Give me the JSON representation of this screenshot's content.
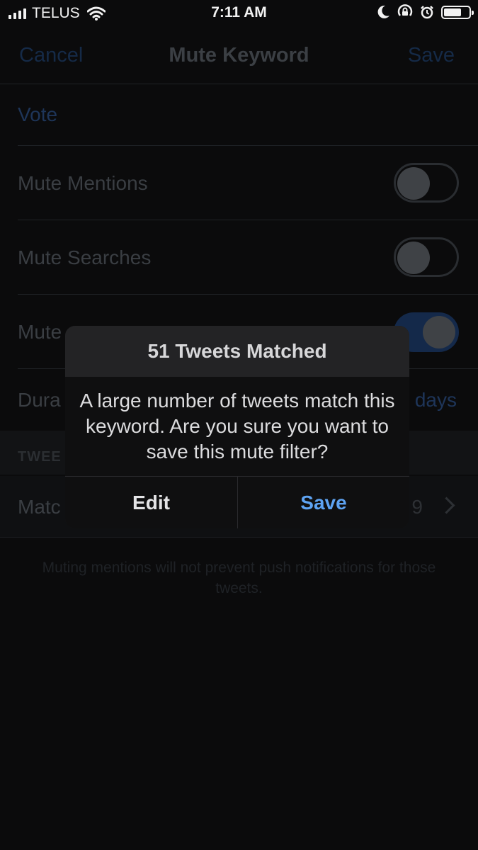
{
  "status_bar": {
    "carrier": "TELUS",
    "time": "7:11 AM",
    "icons": [
      "signal-icon",
      "wifi-icon",
      "moon-icon",
      "orientation-lock-icon",
      "alarm-icon",
      "battery-icon"
    ]
  },
  "nav": {
    "cancel": "Cancel",
    "title": "Mute Keyword",
    "save": "Save"
  },
  "keyword": {
    "value": "Vote"
  },
  "settings": {
    "mute_mentions": {
      "label": "Mute Mentions",
      "enabled": false
    },
    "mute_searches": {
      "label": "Mute Searches",
      "enabled": false
    },
    "mute_lists": {
      "label_visible": "Mute ",
      "enabled": true
    },
    "duration": {
      "label_visible": "Dura",
      "value_visible": "days"
    }
  },
  "section": {
    "header_visible": "TWEE",
    "match_label_visible": "Matc",
    "match_value_visible": "9"
  },
  "footnote": "Muting mentions will not prevent push notifications for those tweets.",
  "alert": {
    "title": "51 Tweets Matched",
    "message": "A large number of tweets match this keyword. Are you sure you want to save this mute filter?",
    "edit": "Edit",
    "save": "Save"
  },
  "colors": {
    "accent": "#5ea3f2",
    "background": "#0b0b0c",
    "alert_background": "#1c1c1e"
  }
}
